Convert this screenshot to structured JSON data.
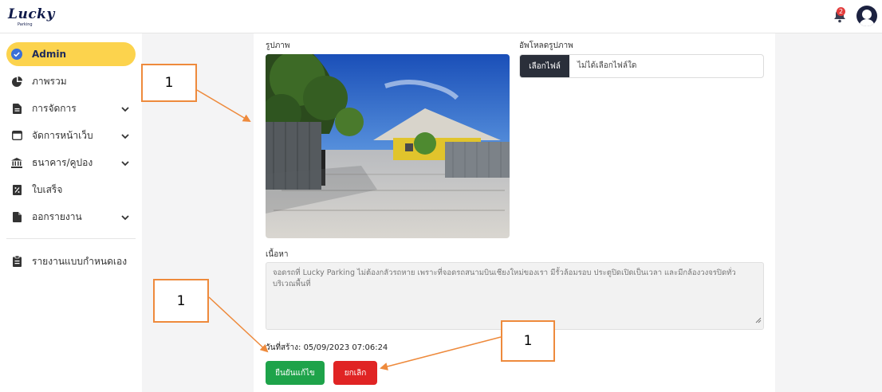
{
  "header": {
    "logo_text": "Lucky",
    "logo_sub": "Parking",
    "notification_count": "2"
  },
  "sidebar": {
    "items": [
      {
        "label": "Admin",
        "icon": "check-circle-icon",
        "active": true,
        "has_submenu": false
      },
      {
        "label": "ภาพรวม",
        "icon": "pie-chart-icon",
        "active": false,
        "has_submenu": false
      },
      {
        "label": "การจัดการ",
        "icon": "file-icon",
        "active": false,
        "has_submenu": true
      },
      {
        "label": "จัดการหน้าเว็บ",
        "icon": "window-icon",
        "active": false,
        "has_submenu": true
      },
      {
        "label": "ธนาคาร/คูปอง",
        "icon": "bank-icon",
        "active": false,
        "has_submenu": true
      },
      {
        "label": "ใบเสร็จ",
        "icon": "receipt-icon",
        "active": false,
        "has_submenu": false
      },
      {
        "label": "ออกรายงาน",
        "icon": "report-icon",
        "active": false,
        "has_submenu": true
      },
      {
        "label": "รายงานแบบกำหนดเอง",
        "icon": "clipboard-icon",
        "active": false,
        "has_submenu": false
      }
    ]
  },
  "form": {
    "image_label": "รูปภาพ",
    "upload_label": "อัพโหลดรูปภาพ",
    "choose_file_button": "เลือกไฟล์",
    "no_file_text": "ไม่ได้เลือกไฟล์ใด",
    "content_label": "เนื้อหา",
    "content_text": "จอดรถที่ Lucky Parking ไม่ต้องกลัวรถหาย เพราะที่จอดรถสนามบินเชียงใหม่ของเรา มีรั้วล้อมรอบ ประตูปิดเปิดเป็นเวลา และมีกล้องวงจรปิดทั่วบริเวณพื้นที่",
    "created_text": "วันที่สร้าง: 05/09/2023 07:06:24",
    "confirm_button": "ยืนยันแก้ไข",
    "cancel_button": "ยกเลิก"
  },
  "annotations": {
    "a1": "1",
    "a2": "1",
    "a3": "1"
  },
  "colors": {
    "active_nav": "#fcd34d",
    "confirm": "#1ea34a",
    "cancel": "#e02424",
    "annotation": "#ee8a3c"
  }
}
